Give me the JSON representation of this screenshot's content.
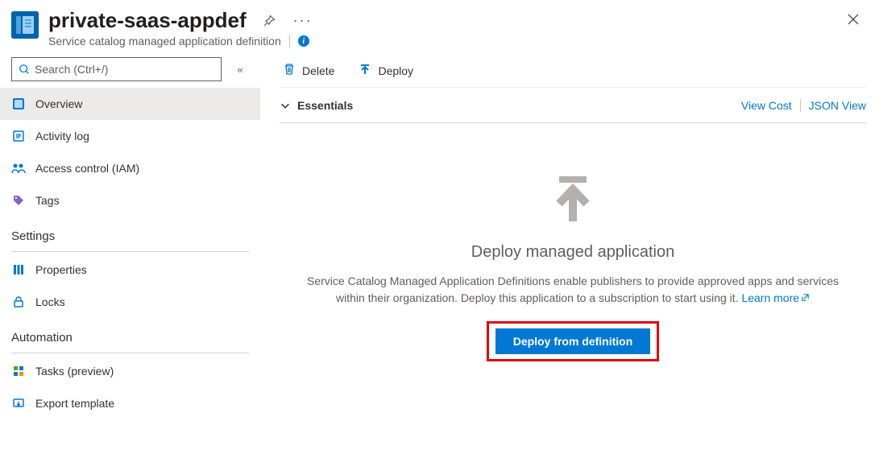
{
  "header": {
    "title": "private-saas-appdef",
    "subtitle": "Service catalog managed application definition"
  },
  "search": {
    "placeholder": "Search (Ctrl+/)"
  },
  "nav": {
    "items": [
      {
        "label": "Overview"
      },
      {
        "label": "Activity log"
      },
      {
        "label": "Access control (IAM)"
      },
      {
        "label": "Tags"
      }
    ],
    "sections": {
      "settings": {
        "title": "Settings",
        "items": [
          {
            "label": "Properties"
          },
          {
            "label": "Locks"
          }
        ]
      },
      "automation": {
        "title": "Automation",
        "items": [
          {
            "label": "Tasks (preview)"
          },
          {
            "label": "Export template"
          }
        ]
      }
    }
  },
  "toolbar": {
    "delete": "Delete",
    "deploy": "Deploy"
  },
  "essentials": {
    "label": "Essentials",
    "viewCost": "View Cost",
    "jsonView": "JSON View"
  },
  "hero": {
    "title": "Deploy managed application",
    "desc": "Service Catalog Managed Application Definitions enable publishers to provide approved apps and services within their organization. Deploy this application to a subscription to start using it. ",
    "learnMore": "Learn more",
    "button": "Deploy from definition"
  }
}
